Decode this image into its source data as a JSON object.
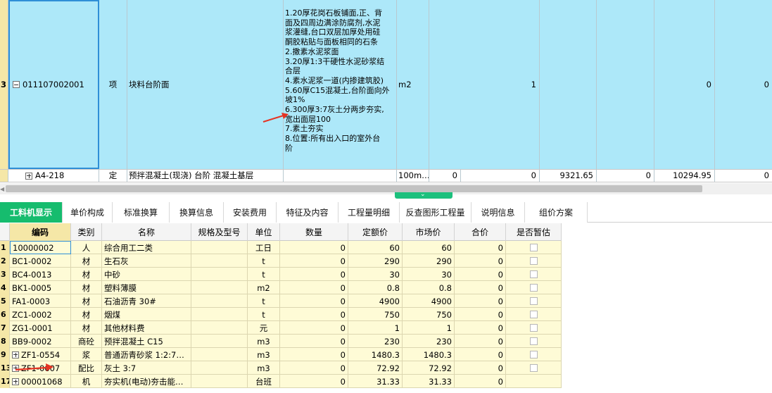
{
  "upper": {
    "main_row": {
      "row_number": "3",
      "code": "011107002001",
      "category": "项",
      "name": "块料台阶面",
      "description_lines": [
        "1.20厚花岗石板铺面,正、背",
        "面及四周边满涂防腐剂,水泥",
        "浆灌缝,台口双层加厚处用硅",
        "酮胶粘贴与面板相同的石条",
        "2.撒素水泥浆面",
        "3.20厚1:3干硬性水泥砂浆结",
        "合层",
        "4.素水泥浆一道(内掺建筑胶)",
        "5.60厚C15混凝土,台阶面向外",
        "坡1%",
        "6.300厚3:7灰土分两步夯实,",
        "宽出面层100",
        "7.素土夯实",
        "8.位置:所有出入口的室外台",
        "阶"
      ],
      "unit": "m2",
      "quantity": "1",
      "value_a": "0",
      "value_b": "0"
    },
    "sub_row": {
      "code": "A4-218",
      "category": "定",
      "name": "预拌混凝土(现浇) 台阶 混凝土基层",
      "unit": "100m…",
      "quantity": "0",
      "value_1": "0",
      "value_2": "9321.65",
      "value_3": "0",
      "value_4": "10294.95",
      "value_5": "0"
    }
  },
  "tabs": [
    {
      "label": "工料机显示",
      "active": true
    },
    {
      "label": "单价构成",
      "active": false
    },
    {
      "label": "标准换算",
      "active": false
    },
    {
      "label": "换算信息",
      "active": false
    },
    {
      "label": "安装费用",
      "active": false
    },
    {
      "label": "特征及内容",
      "active": false
    },
    {
      "label": "工程量明细",
      "active": false
    },
    {
      "label": "反查图形工程量",
      "active": false
    },
    {
      "label": "说明信息",
      "active": false
    },
    {
      "label": "组价方案",
      "active": false
    }
  ],
  "lower": {
    "headers": [
      "编码",
      "类别",
      "名称",
      "规格及型号",
      "单位",
      "数量",
      "定额价",
      "市场价",
      "合价",
      "是否暂估"
    ],
    "rows": [
      {
        "rn": "1",
        "code": "10000002",
        "type": "人",
        "name": "综合用工二类",
        "spec": "",
        "unit": "工日",
        "qty": "0",
        "quota": "60",
        "market": "60",
        "total": "0",
        "check": true
      },
      {
        "rn": "2",
        "code": "BC1-0002",
        "type": "材",
        "name": "生石灰",
        "spec": "",
        "unit": "t",
        "qty": "0",
        "quota": "290",
        "market": "290",
        "total": "0",
        "check": true
      },
      {
        "rn": "3",
        "code": "BC4-0013",
        "type": "材",
        "name": "中砂",
        "spec": "",
        "unit": "t",
        "qty": "0",
        "quota": "30",
        "market": "30",
        "total": "0",
        "check": true
      },
      {
        "rn": "4",
        "code": "BK1-0005",
        "type": "材",
        "name": "塑料薄膜",
        "spec": "",
        "unit": "m2",
        "qty": "0",
        "quota": "0.8",
        "market": "0.8",
        "total": "0",
        "check": true
      },
      {
        "rn": "5",
        "code": "FA1-0003",
        "type": "材",
        "name": "石油沥青 30#",
        "spec": "",
        "unit": "t",
        "qty": "0",
        "quota": "4900",
        "market": "4900",
        "total": "0",
        "check": true
      },
      {
        "rn": "6",
        "code": "ZC1-0002",
        "type": "材",
        "name": "烟煤",
        "spec": "",
        "unit": "t",
        "qty": "0",
        "quota": "750",
        "market": "750",
        "total": "0",
        "check": true
      },
      {
        "rn": "7",
        "code": "ZG1-0001",
        "type": "材",
        "name": "其他材料费",
        "spec": "",
        "unit": "元",
        "qty": "0",
        "quota": "1",
        "market": "1",
        "total": "0",
        "check": true
      },
      {
        "rn": "8",
        "code": "BB9-0002",
        "type": "商砼",
        "name": "预拌混凝土 C15",
        "spec": "",
        "unit": "m3",
        "qty": "0",
        "quota": "230",
        "market": "230",
        "total": "0",
        "check": true
      },
      {
        "rn": "9",
        "code": "ZF1-0554",
        "type": "浆",
        "name": "普通沥青砂浆 1:2:7…",
        "spec": "",
        "unit": "m3",
        "qty": "0",
        "quota": "1480.3",
        "market": "1480.3",
        "total": "0",
        "check": true,
        "expand": true
      },
      {
        "rn": "13",
        "code": "ZF1-0607",
        "type": "配比",
        "name": "灰土 3:7",
        "spec": "",
        "unit": "m3",
        "qty": "0",
        "quota": "72.92",
        "market": "72.92",
        "total": "0",
        "check": true,
        "expand": true
      },
      {
        "rn": "17",
        "code": "00001068",
        "type": "机",
        "name": "夯实机(电动)夯击能…",
        "spec": "",
        "unit": "台班",
        "qty": "0",
        "quota": "31.33",
        "market": "31.33",
        "total": "0",
        "check": false,
        "expand": true
      }
    ]
  },
  "colors": {
    "selected_row": "#ade8f9",
    "active_tab": "#16bc6e",
    "lower_row": "#fefbd6",
    "row_number_bg": "#f5e7a7",
    "arrow": "#e53323"
  }
}
